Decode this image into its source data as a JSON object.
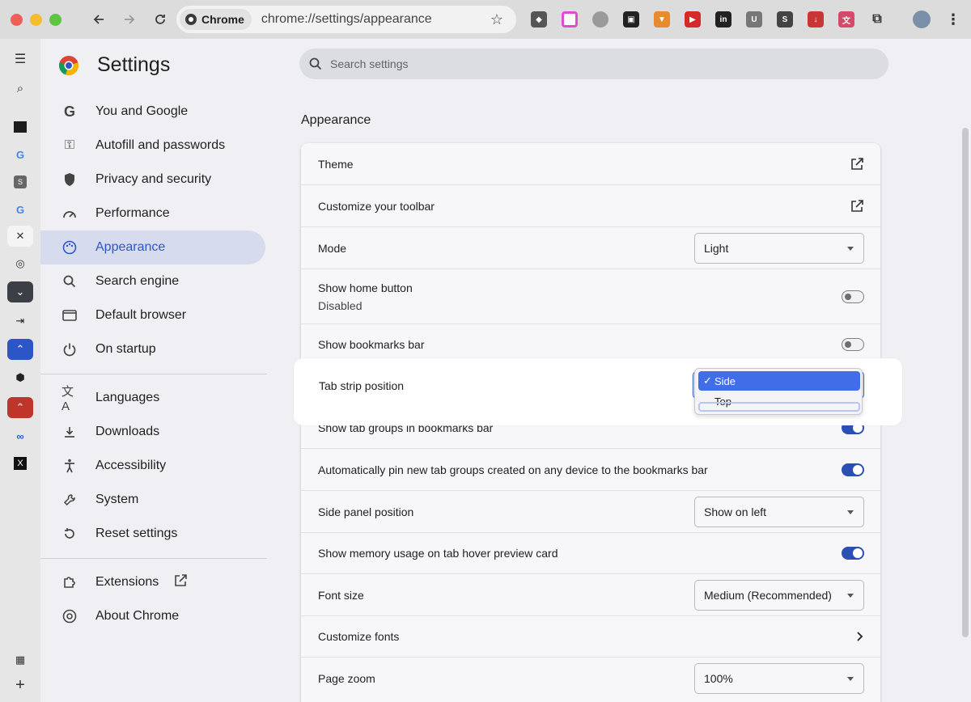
{
  "browser": {
    "site_chip": "Chrome",
    "url": "chrome://settings/appearance"
  },
  "settings": {
    "title": "Settings",
    "search_placeholder": "Search settings",
    "nav": [
      {
        "label": "You and Google",
        "icon": "google-g-icon"
      },
      {
        "label": "Autofill and passwords",
        "icon": "key-icon"
      },
      {
        "label": "Privacy and security",
        "icon": "shield-icon"
      },
      {
        "label": "Performance",
        "icon": "speedometer-icon"
      },
      {
        "label": "Appearance",
        "icon": "palette-icon",
        "active": true
      },
      {
        "label": "Search engine",
        "icon": "search-icon"
      },
      {
        "label": "Default browser",
        "icon": "browser-window-icon"
      },
      {
        "label": "On startup",
        "icon": "power-icon"
      },
      {
        "label": "Languages",
        "icon": "translate-icon"
      },
      {
        "label": "Downloads",
        "icon": "download-icon"
      },
      {
        "label": "Accessibility",
        "icon": "accessibility-icon"
      },
      {
        "label": "System",
        "icon": "wrench-icon"
      },
      {
        "label": "Reset settings",
        "icon": "reset-icon"
      },
      {
        "label": "Extensions",
        "icon": "puzzle-icon"
      },
      {
        "label": "About Chrome",
        "icon": "chrome-logo-icon"
      }
    ],
    "section_title": "Appearance",
    "rows": {
      "theme": "Theme",
      "toolbar": "Customize your toolbar",
      "mode": "Mode",
      "mode_value": "Light",
      "home_button": "Show home button",
      "home_button_sub": "Disabled",
      "bookmarks_bar": "Show bookmarks bar",
      "tab_strip": "Tab strip position",
      "tab_groups": "Show tab groups in bookmarks bar",
      "pin_groups": "Automatically pin new tab groups created on any device to the bookmarks bar",
      "side_panel": "Side panel position",
      "side_panel_value": "Show on left",
      "memory": "Show memory usage on tab hover preview card",
      "font_size": "Font size",
      "font_size_value": "Medium (Recommended)",
      "custom_fonts": "Customize fonts",
      "page_zoom": "Page zoom",
      "page_zoom_value": "100%"
    },
    "toggles": {
      "home_button": false,
      "bookmarks_bar": false,
      "tab_groups": true,
      "pin_groups": true,
      "memory": true
    },
    "dropdown": {
      "options": [
        "Side",
        "Top"
      ],
      "selected": "Side"
    }
  },
  "colors": {
    "accent": "#2f56c9",
    "selection": "#3f6ee8",
    "toggle_on": "#2c4fb4"
  }
}
